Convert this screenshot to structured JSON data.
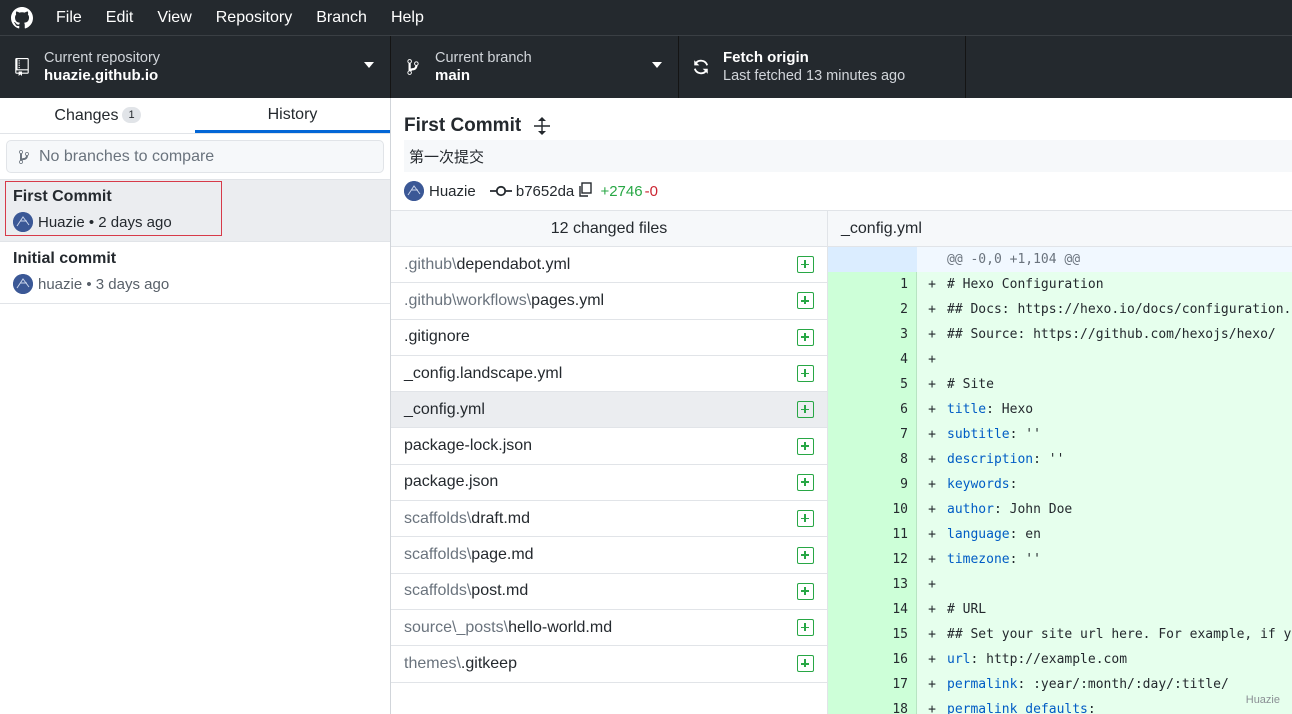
{
  "menu": [
    "File",
    "Edit",
    "View",
    "Repository",
    "Branch",
    "Help"
  ],
  "toolbar": {
    "repo_desc": "Current repository",
    "repo_name": "huazie.github.io",
    "branch_desc": "Current branch",
    "branch_name": "main",
    "fetch_title": "Fetch origin",
    "fetch_desc": "Last fetched 13 minutes ago"
  },
  "sidebar": {
    "tab_changes": "Changes",
    "tab_changes_count": "1",
    "tab_history": "History",
    "compare_placeholder": "No branches to compare",
    "commits": [
      {
        "summary": "First Commit",
        "author": "Huazie",
        "time": "2 days ago"
      },
      {
        "summary": "Initial commit",
        "author": "huazie",
        "time": "3 days ago"
      }
    ]
  },
  "commit": {
    "title": "First Commit",
    "description": "第一次提交",
    "author": "Huazie",
    "sha": "b7652da",
    "additions": "+2746",
    "deletions": "-0"
  },
  "files": {
    "header": "12 changed files",
    "items": [
      {
        "dir": ".github\\",
        "name": "dependabot.yml"
      },
      {
        "dir": ".github\\workflows\\",
        "name": "pages.yml"
      },
      {
        "dir": "",
        "name": ".gitignore"
      },
      {
        "dir": "",
        "name": "_config.landscape.yml"
      },
      {
        "dir": "",
        "name": "_config.yml"
      },
      {
        "dir": "",
        "name": "package-lock.json"
      },
      {
        "dir": "",
        "name": "package.json"
      },
      {
        "dir": "scaffolds\\",
        "name": "draft.md"
      },
      {
        "dir": "scaffolds\\",
        "name": "page.md"
      },
      {
        "dir": "scaffolds\\",
        "name": "post.md"
      },
      {
        "dir": "source\\_posts\\",
        "name": "hello-world.md"
      },
      {
        "dir": "themes\\",
        "name": ".gitkeep"
      }
    ]
  },
  "diff": {
    "file": "_config.yml",
    "hunk": "@@ -0,0 +1,104 @@",
    "lines": [
      {
        "n": "1",
        "key": "",
        "text": "# Hexo Configuration"
      },
      {
        "n": "2",
        "key": "",
        "text": "## Docs: https://hexo.io/docs/configuration.h"
      },
      {
        "n": "3",
        "key": "",
        "text": "## Source: https://github.com/hexojs/hexo/"
      },
      {
        "n": "4",
        "key": "",
        "text": ""
      },
      {
        "n": "5",
        "key": "",
        "text": "# Site"
      },
      {
        "n": "6",
        "key": "title",
        "text": " Hexo"
      },
      {
        "n": "7",
        "key": "subtitle",
        "text": " ''"
      },
      {
        "n": "8",
        "key": "description",
        "text": " ''"
      },
      {
        "n": "9",
        "key": "keywords",
        "text": ""
      },
      {
        "n": "10",
        "key": "author",
        "text": " John Doe"
      },
      {
        "n": "11",
        "key": "language",
        "text": " en"
      },
      {
        "n": "12",
        "key": "timezone",
        "text": " ''"
      },
      {
        "n": "13",
        "key": "",
        "text": ""
      },
      {
        "n": "14",
        "key": "",
        "text": "# URL"
      },
      {
        "n": "15",
        "key": "",
        "text": "## Set your site url here. For example, if yo"
      },
      {
        "n": "16",
        "key": "url",
        "text": " http://example.com"
      },
      {
        "n": "17",
        "key": "permalink",
        "text": " :year/:month/:day/:title/"
      },
      {
        "n": "18",
        "key": "permalink_defaults",
        "text": ""
      }
    ],
    "watermark": "Huazie"
  }
}
